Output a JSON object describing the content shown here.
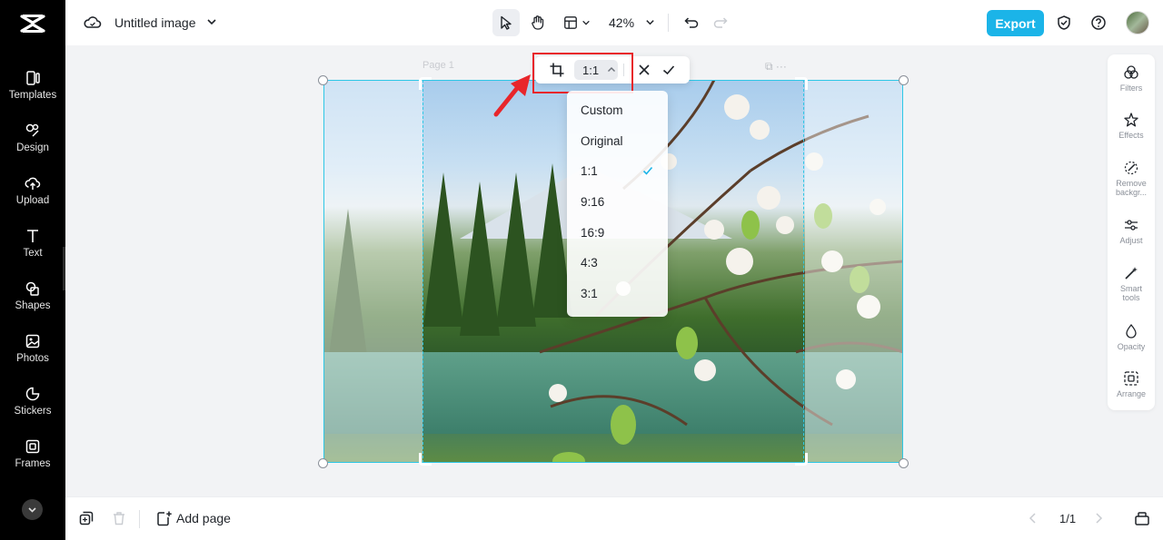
{
  "app": {
    "title": "Untitled image"
  },
  "sidebar": {
    "items": [
      {
        "label": "Templates",
        "icon": "templates-icon"
      },
      {
        "label": "Design",
        "icon": "design-icon"
      },
      {
        "label": "Upload",
        "icon": "upload-icon"
      },
      {
        "label": "Text",
        "icon": "text-icon"
      },
      {
        "label": "Shapes",
        "icon": "shapes-icon"
      },
      {
        "label": "Photos",
        "icon": "photos-icon"
      },
      {
        "label": "Stickers",
        "icon": "stickers-icon"
      },
      {
        "label": "Frames",
        "icon": "frames-icon"
      }
    ]
  },
  "topbar": {
    "zoom": "42%",
    "export_label": "Export"
  },
  "canvas": {
    "page_label": "Page 1",
    "page_actions": "⧉ ···"
  },
  "crop_toolbar": {
    "ratio": "1:1"
  },
  "ratio_menu": {
    "selected": "1:1",
    "options": [
      "Custom",
      "Original",
      "1:1",
      "9:16",
      "16:9",
      "4:3",
      "3:1"
    ]
  },
  "right_panel": {
    "items": [
      {
        "label": "Filters",
        "icon": "filters-icon"
      },
      {
        "label": "Effects",
        "icon": "effects-icon"
      },
      {
        "label": "Remove backgr...",
        "icon": "remove-background-icon"
      },
      {
        "label": "Adjust",
        "icon": "adjust-icon"
      },
      {
        "label": "Smart tools",
        "icon": "smart-tools-icon"
      },
      {
        "label": "Opacity",
        "icon": "opacity-icon"
      },
      {
        "label": "Arrange",
        "icon": "arrange-icon"
      }
    ]
  },
  "bottombar": {
    "add_page_label": "Add page",
    "page_indicator": "1/1"
  },
  "colors": {
    "accent": "#1bb4e8",
    "selection": "#2ec7e6",
    "highlight": "#e8262b"
  }
}
